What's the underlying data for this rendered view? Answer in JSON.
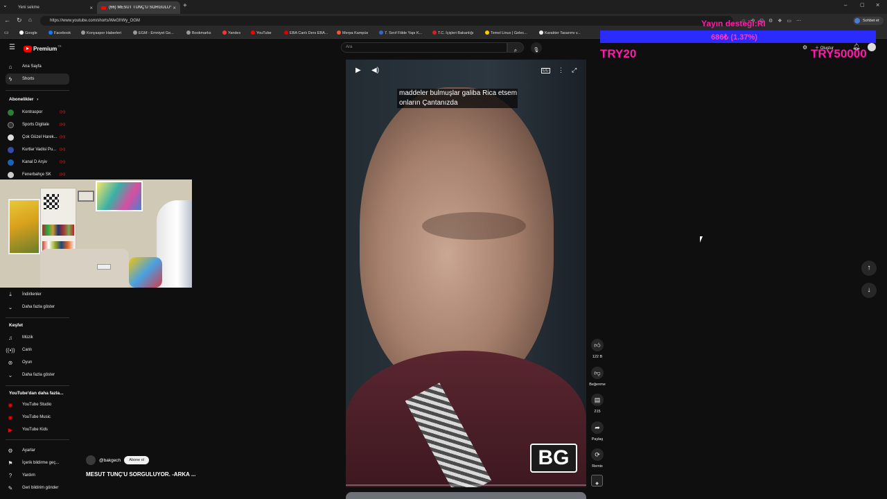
{
  "browser": {
    "tabs": [
      {
        "title": "Yeni sekme"
      },
      {
        "title": "(66) MESUT TUNÇ'U SORGULUYOR"
      }
    ],
    "url": "https://www.youtube.com/shorts/WeGfrWy_OGM",
    "bookmarks": [
      "Google",
      "Facebook",
      "Konyaspor Haberleri",
      "EGM - Emniyet Ge...",
      "Bookmarks",
      "Yandex",
      "YouTube",
      "EBA Canlı Ders EBA...",
      "Merpa Kampüs",
      "7. Sınıf Fiilde Yapı K...",
      "T.C. İçişleri Bakanlığı",
      "Temel Linux | Gelec...",
      "Karakter Tasarımı v..."
    ],
    "profile_label": "Sohbet et"
  },
  "youtube": {
    "logo": "Premium",
    "logo_badge": "TR",
    "search_placeholder": "Ara",
    "nav": [
      {
        "label": "Ana Sayfa",
        "icon": "home-icon"
      },
      {
        "label": "Shorts",
        "icon": "shorts-icon"
      }
    ],
    "subscriptions_title": "Abonelikler",
    "subscriptions": [
      {
        "label": "Kontraspor",
        "color": "#2e7d32"
      },
      {
        "label": "Sports Digitale",
        "color": "#333333"
      },
      {
        "label": "Çok Güzel Harek...",
        "color": "#dddddd"
      },
      {
        "label": "Kurtlar Vadisi Pu...",
        "color": "#3949ab"
      },
      {
        "label": "Kanal D Arşiv",
        "color": "#1565c0"
      },
      {
        "label": "Fenerbahçe SK",
        "color": "#cccccc"
      }
    ],
    "downloads_label": "İndirilenler",
    "show_more_1": "Daha fazla göster",
    "explore_title": "Keşfet",
    "explore": [
      {
        "label": "Müzik",
        "icon": "music-icon"
      },
      {
        "label": "Canlı",
        "icon": "live-icon"
      },
      {
        "label": "Oyun",
        "icon": "game-icon"
      }
    ],
    "show_more_2": "Daha fazla göster",
    "more_title": "YouTube'dan daha fazla...",
    "more_items": [
      {
        "label": "YouTube Studio"
      },
      {
        "label": "YouTube Music"
      },
      {
        "label": "YouTube Kids"
      }
    ],
    "settings": [
      {
        "label": "Ayarlar",
        "icon": "gear-icon"
      },
      {
        "label": "İçerik bildirme geç...",
        "icon": "flag-icon"
      },
      {
        "label": "Yardım",
        "icon": "help-icon"
      },
      {
        "label": "Geri bildirim gönder",
        "icon": "feedback-icon"
      }
    ],
    "short": {
      "subtitle_line1": "maddeler bulmuşlar galiba Rica etsem",
      "subtitle_line2": "onların Çantanızda",
      "watermark": "BG",
      "channel": "@bakgech",
      "subscribe_label": "Abone ol",
      "title": "MESUT TUNÇ'U SORGULUYOR. -ARKA ...",
      "likes": "122 B",
      "dislike_label": "Beğenme",
      "comments": "215",
      "share_label": "Paylaş",
      "remix_label": "Remix",
      "progress": 0.0
    },
    "header_right": {
      "create_label": "Oluştur"
    }
  },
  "overlay": {
    "donation_title": "Yayın desteği:RI",
    "donation_amount": "686₺ (1.37%)",
    "left_text": "TRY20",
    "right_text": "TRY50000",
    "accent": "#ff1aa8",
    "bar_color": "#2a2cff",
    "donation_progress": 0.0137
  }
}
